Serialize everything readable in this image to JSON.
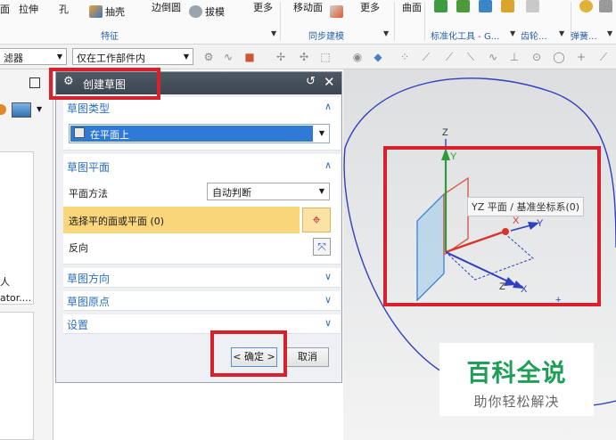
{
  "ribbon": {
    "items": [
      {
        "label": "面",
        "icon": "face-icon"
      },
      {
        "label": "拉伸",
        "icon": "extrude-icon"
      },
      {
        "label": "孔",
        "icon": "hole-icon"
      },
      {
        "label": "抽壳",
        "icon": "shell-icon"
      },
      {
        "label": "边倒圆",
        "icon": "edge-blend-icon"
      },
      {
        "label": "拔模",
        "icon": "draft-icon"
      },
      {
        "label": "更多",
        "icon": "more-icon"
      },
      {
        "label": "移动面",
        "icon": "move-face-icon"
      },
      {
        "label": "更多",
        "icon": "more-icon"
      },
      {
        "label": "曲面",
        "icon": "surface-icon"
      }
    ],
    "groups": {
      "feature": "特征",
      "sync": "同步建模",
      "standard": "标准化工具 - G...",
      "gear": "齿轮...",
      "spring": "弹簧..."
    }
  },
  "filterbar": {
    "filter_combo": "滤器",
    "scope_combo": "仅在工作部件内"
  },
  "leftpanel": {
    "text1": "人",
    "text2": "ator...."
  },
  "dialog": {
    "title": "创建草图",
    "sketch_type_header": "草图类型",
    "sketch_type_value": "在平面上",
    "sketch_plane_header": "草图平面",
    "plane_method_label": "平面方法",
    "plane_method_value": "自动判断",
    "select_plane_label": "选择平的面或平面 (0)",
    "reverse_label": "反向",
    "sketch_orientation_header": "草图方向",
    "sketch_origin_header": "草图原点",
    "settings_header": "设置",
    "ok_label": "< 确定 >",
    "cancel_label": "取消"
  },
  "viewport": {
    "tooltip": "YZ 平面 / 基准坐标系(0)",
    "axis_z": "Z",
    "axis_y": "Y",
    "axis_x": "X",
    "axis_z2": "Z",
    "axis_y2": "Y",
    "axis_x2": "X"
  },
  "watermark": {
    "title": "百科全说",
    "subtitle": "助你轻松解决"
  },
  "colors": {
    "highlight_red": "#d7212c",
    "section_blue": "#2c6fc0",
    "selection_yellow": "#f9d67a",
    "watermark_green": "#1e9e56"
  }
}
